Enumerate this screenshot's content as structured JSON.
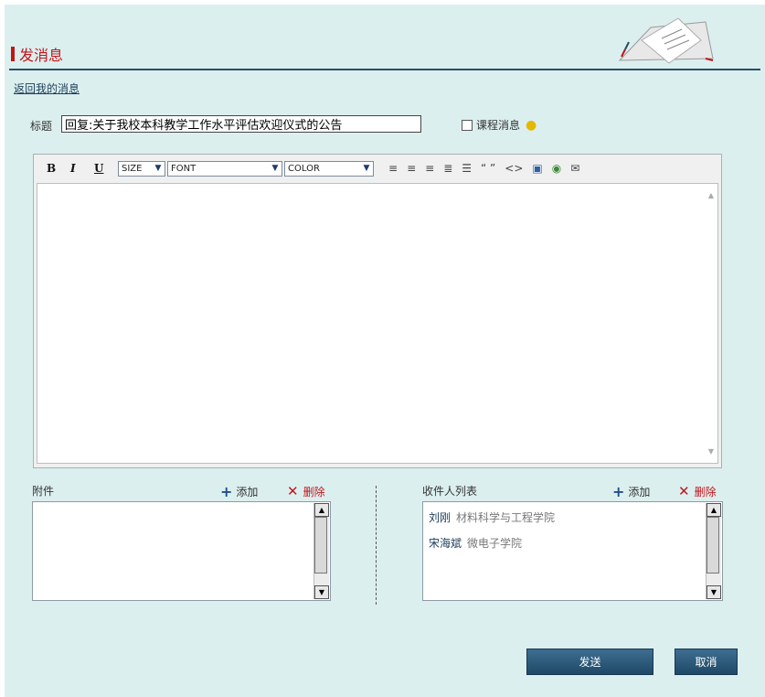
{
  "header": {
    "title": "发消息",
    "back_link": "返回我的消息"
  },
  "form": {
    "subject_label": "标题",
    "subject_value": "回复:关于我校本科教学工作水平评估欢迎仪式的公告",
    "course_label": "课程消息"
  },
  "toolbar": {
    "bold": "B",
    "italic": "I",
    "underline": "U",
    "size": "SIZE",
    "font": "FONT",
    "color": "COLOR",
    "quote": "“ ”",
    "code": "<>"
  },
  "attachments": {
    "label": "附件",
    "add": "添加",
    "delete": "删除"
  },
  "recipients": {
    "label": "收件人列表",
    "add": "添加",
    "delete": "删除",
    "items": [
      {
        "name": "刘刚",
        "school": "材料科学与工程学院"
      },
      {
        "name": "宋海斌",
        "school": "微电子学院"
      }
    ]
  },
  "actions": {
    "send": "发送",
    "cancel": "取消"
  },
  "colors": {
    "accent": "#c0161a",
    "primary": "#2b4f66"
  }
}
